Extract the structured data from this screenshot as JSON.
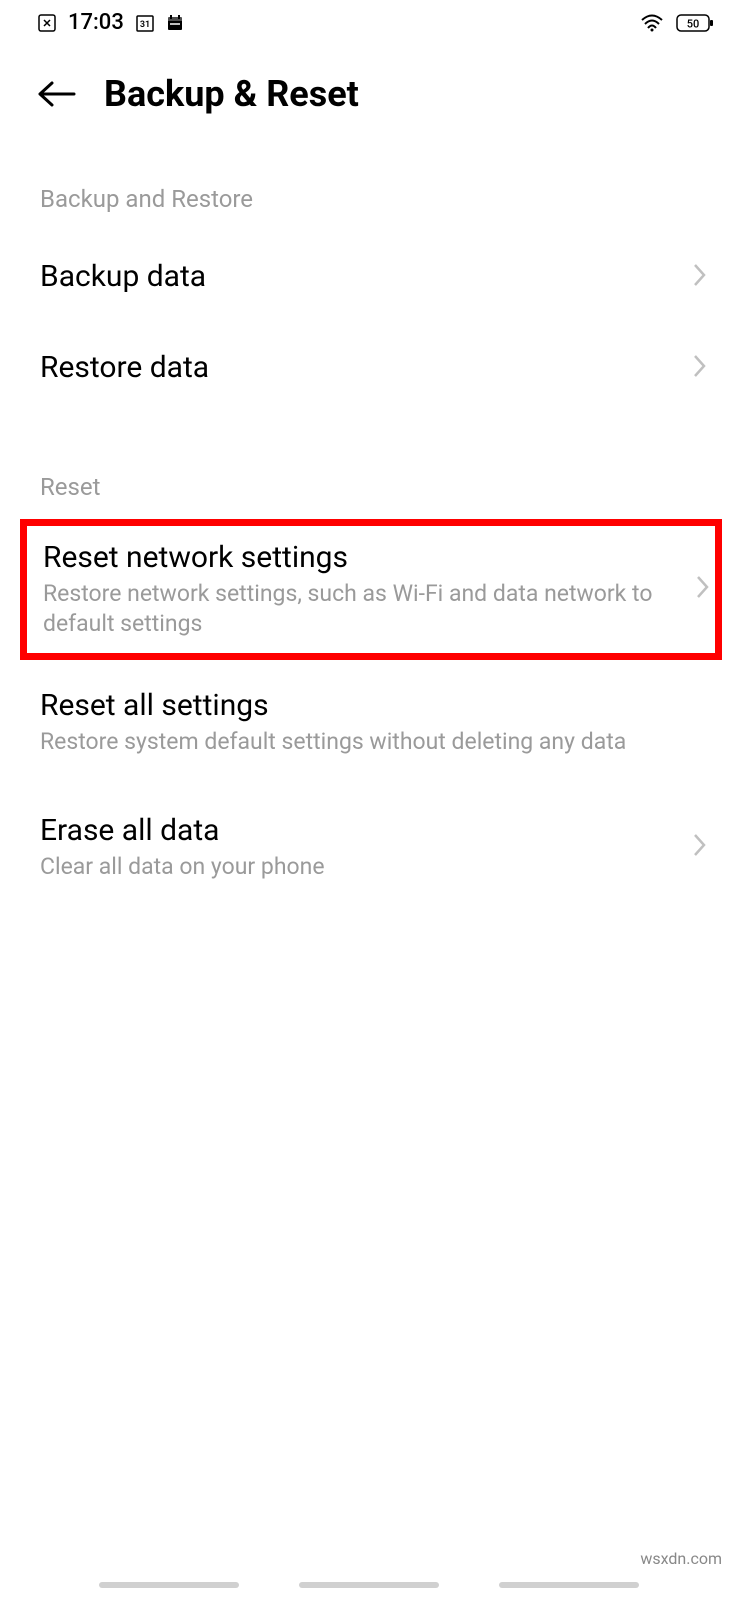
{
  "status_bar": {
    "time": "17:03",
    "battery": "50"
  },
  "header": {
    "title": "Backup & Reset"
  },
  "sections": {
    "backup_restore": {
      "header": "Backup and Restore",
      "items": [
        {
          "title": "Backup data"
        },
        {
          "title": "Restore data"
        }
      ]
    },
    "reset": {
      "header": "Reset",
      "items": [
        {
          "title": "Reset network settings",
          "subtitle": "Restore network settings, such as Wi-Fi and data network to default settings"
        },
        {
          "title": "Reset all settings",
          "subtitle": "Restore system default settings without deleting any data"
        },
        {
          "title": "Erase all data",
          "subtitle": "Clear all data on your phone"
        }
      ]
    }
  },
  "watermark": "wsxdn.com"
}
